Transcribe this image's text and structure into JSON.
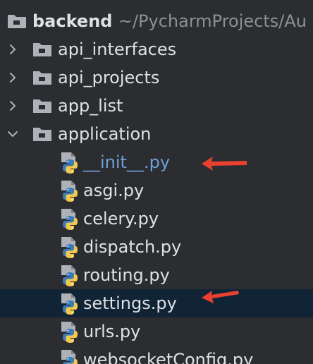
{
  "project": {
    "name": "backend",
    "path": "~/PycharmProjects/Au"
  },
  "folders": [
    {
      "label": "api_interfaces",
      "expanded": false
    },
    {
      "label": "api_projects",
      "expanded": false
    },
    {
      "label": "app_list",
      "expanded": false
    },
    {
      "label": "application",
      "expanded": true
    }
  ],
  "files": [
    {
      "label": "__init__.py",
      "highlight": true
    },
    {
      "label": "asgi.py"
    },
    {
      "label": "celery.py"
    },
    {
      "label": "dispatch.py"
    },
    {
      "label": "routing.py"
    },
    {
      "label": "settings.py",
      "selected": true
    },
    {
      "label": "urls.py"
    },
    {
      "label": "websocketConfig.py"
    }
  ],
  "colors": {
    "background": "#2b2d30",
    "selected_row": "#112436",
    "init_file_text": "#6f9fd8",
    "annotation_arrow": "#e8412f"
  },
  "icons": {
    "folder": "folder-icon",
    "python_file": "python-file-icon",
    "collapsed": "chevron-right-icon",
    "expanded": "chevron-down-icon"
  }
}
